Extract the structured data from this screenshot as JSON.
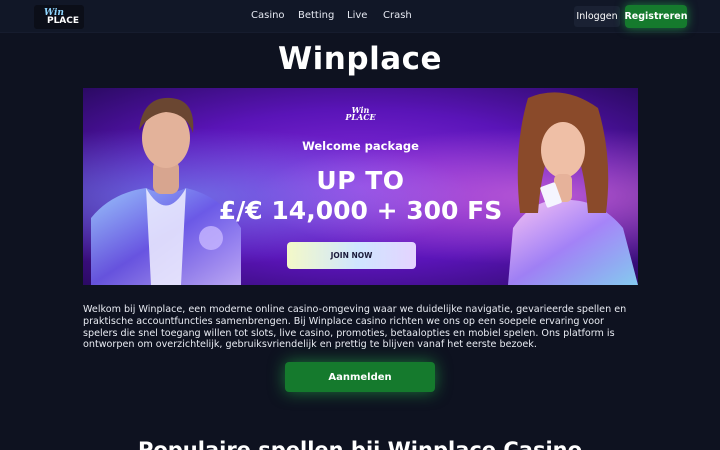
{
  "header": {
    "logo": {
      "line1": "Win",
      "line2": "PLACE"
    },
    "nav": [
      {
        "label": "Casino"
      },
      {
        "label": "Betting"
      },
      {
        "label": "Live"
      },
      {
        "label": "Crash"
      }
    ],
    "login_label": "Inloggen",
    "register_label": "Registreren"
  },
  "main": {
    "title": "Winplace",
    "banner": {
      "logo_line1": "Win",
      "logo_line2": "PLACE",
      "welcome": "Welcome package",
      "upto": "UP TO",
      "amount": "£/€ 14,000 + 300 FS",
      "cta": "JOIN NOW"
    },
    "intro": "Welkom bij Winplace, een moderne online casino-omgeving waar we duidelijke navigatie, gevarieerde spellen en praktische accountfuncties samenbrengen. Bij Winplace casino richten we ons op een soepele ervaring voor spelers die snel toegang willen tot slots, live casino, promoties, betaalopties en mobiel spelen. Ons platform is ontworpen om overzichtelijk, gebruiksvriendelijk en prettig te blijven vanaf het eerste bezoek.",
    "cta_label": "Aanmelden",
    "section_title": "Populaire spellen bij Winplace Casino"
  },
  "colors": {
    "background": "#0e1220",
    "header": "#111727",
    "accent_green": "#157a2d",
    "banner_purple": "#8a2fe0"
  }
}
